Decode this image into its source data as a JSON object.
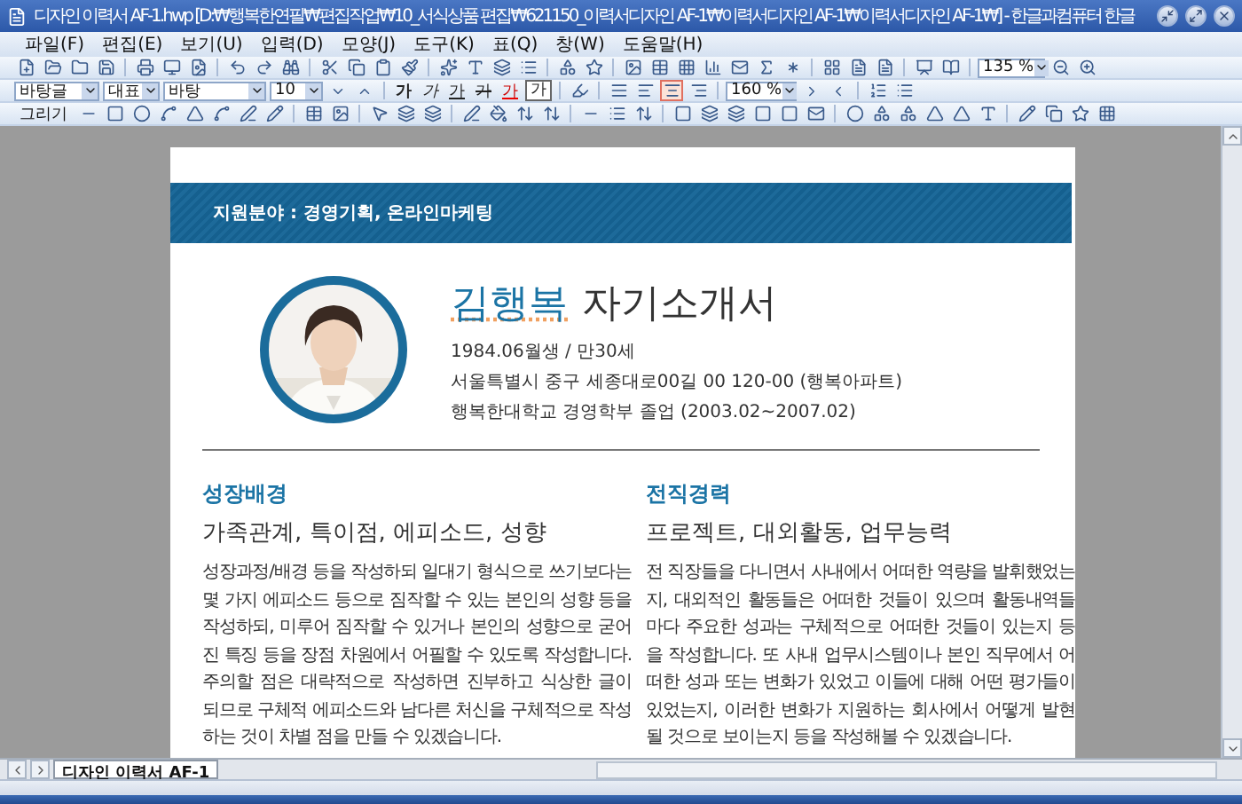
{
  "window": {
    "title": "디자인 이력서 AF-1.hwp [D:₩행복한연필₩편집작업₩10_서식상품 편집₩621150_이력서디자인 AF-1₩이력서디자인 AF-1₩이력서디자인 AF-1₩] - 한글과컴퓨터 한글"
  },
  "menu": [
    "파일(F)",
    "편집(E)",
    "보기(U)",
    "입력(D)",
    "모양(J)",
    "도구(K)",
    "표(Q)",
    "창(W)",
    "도움말(H)"
  ],
  "toolbar_standard": {
    "zoom": "135 %"
  },
  "toolbar_format": {
    "style": "바탕글",
    "font_group": "대표",
    "font": "바탕",
    "size": "10",
    "char_buttons": [
      {
        "kind": "bold",
        "label": "가"
      },
      {
        "kind": "italic",
        "label": "가"
      },
      {
        "kind": "underline",
        "label": "가"
      },
      {
        "kind": "strike",
        "label": "가"
      },
      {
        "kind": "color",
        "label": "가"
      },
      {
        "kind": "outline",
        "label": "가"
      }
    ],
    "align_buttons": [
      {
        "kind": "justify",
        "selected": false
      },
      {
        "kind": "left",
        "selected": false
      },
      {
        "kind": "center",
        "selected": true
      },
      {
        "kind": "right",
        "selected": false
      }
    ],
    "line_spacing": "160 %"
  },
  "toolbar_drawing": {
    "label": "그리기"
  },
  "document": {
    "banner": "지원분야 : 경영기획, 온라인마케팅",
    "photo": {
      "kind": "picture"
    },
    "name": "김행복",
    "title": "자기소개서",
    "info": [
      "1984.06월생 / 만30세",
      "서울특별시 중구 세종대로00길 00 120-00 (행복아파트)",
      "행복한대학교 경영학부 졸업 (2003.02~2007.02)"
    ],
    "sections": [
      {
        "heading": "성장배경",
        "subheading": "가족관계, 특이점, 에피소드, 성향",
        "body": "성장과정/배경 등을 작성하되 일대기 형식으로 쓰기보다는 몇 가지 에피소드 등으로 짐작할 수 있는 본인의 성향 등을 작성하되, 미루어 짐작할 수 있거나 본인의 성향으로 굳어진 특징 등을 장점 차원에서 어필할 수 있도록 작성합니다. 주의할 점은 대략적으로 작성하면 진부하고 식상한 글이 되므로 구체적 에피소드와 남다른 처신을 구체적으로 작성하는 것이 차별 점을 만들 수 있겠습니다."
      },
      {
        "heading": "전직경력",
        "subheading": "프로젝트, 대외활동, 업무능력",
        "body": "전 직장들을 다니면서 사내에서 어떠한 역량을 발휘했었는지, 대외적인 활동들은 어떠한 것들이 있으며 활동내역들 마다 주요한 성과는 구체적으로 어떠한 것들이 있는지 등을 작성합니다. 또 사내 업무시스템이나 본인 직무에서 어떠한 성과 또는 변화가 있었고 이들에 대해 어떤 평가들이 있었는지, 이러한 변화가 지원하는 회사에서 어떻게 발현될 것으로 보이는지 등을 작성해볼 수 있겠습니다."
      }
    ]
  },
  "document_tabs": [
    {
      "label": "디자인 이력서 AF-1",
      "selected": true
    }
  ]
}
